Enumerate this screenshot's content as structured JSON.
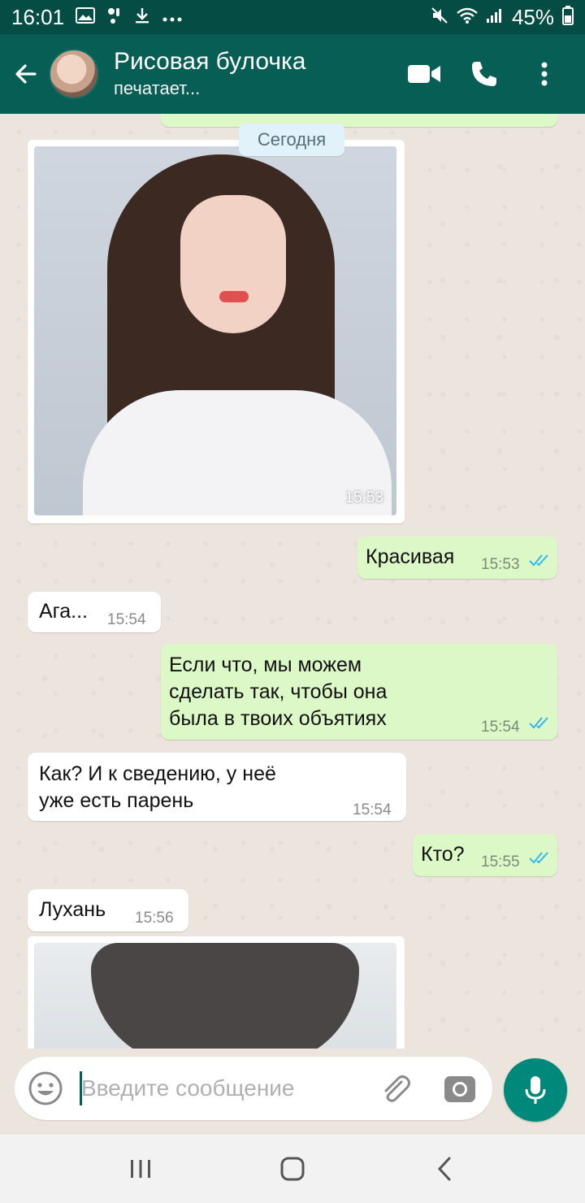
{
  "status_bar": {
    "time": "16:01",
    "battery": "45%",
    "icons_left": [
      "gallery-icon",
      "voicemail-icon",
      "download-icon",
      "more-dots-icon"
    ],
    "icons_right": [
      "mute-icon",
      "wifi-icon",
      "signal-icon"
    ]
  },
  "header": {
    "name": "Рисовая булочка",
    "status": "печатает..."
  },
  "chat": {
    "date_label": "Сегодня",
    "image1_time": "15:53",
    "messages": [
      {
        "dir": "out",
        "text": "Красивая",
        "time": "15:53",
        "read": true
      },
      {
        "dir": "in",
        "text": "Ага...",
        "time": "15:54"
      },
      {
        "dir": "out",
        "line1": "Если что, мы можем",
        "line2": "сделать так, чтобы она",
        "line3": "была в твоих объятиях",
        "time": "15:54",
        "read": true
      },
      {
        "dir": "in",
        "line1": "Как? И к сведению, у неё",
        "line2": "уже есть парень",
        "time": "15:54"
      },
      {
        "dir": "out",
        "text": "Кто?",
        "time": "15:55",
        "read": true
      },
      {
        "dir": "in",
        "text": "Лухань",
        "time": "15:56"
      }
    ],
    "read_color": "#34b7f1"
  },
  "input": {
    "placeholder": "Введите сообщение"
  },
  "colors": {
    "header": "#075e54",
    "status_bar": "#054d44",
    "outgoing": "#dcf8c6",
    "accent": "#00897b"
  }
}
